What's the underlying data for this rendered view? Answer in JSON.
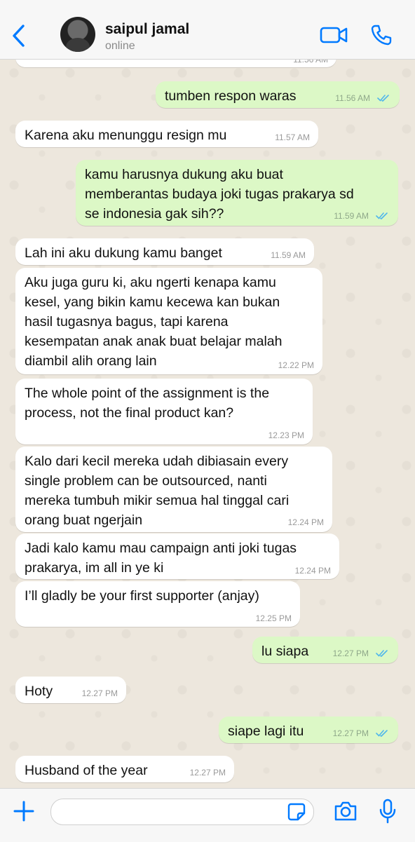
{
  "header": {
    "name": "saipul jamal",
    "status": "online"
  },
  "partial_time": "11.56 AM",
  "messages": [
    {
      "dir": "out",
      "text": "tumben respon waras",
      "time": "11.56 AM",
      "ticks": true
    },
    {
      "dir": "in",
      "text": "Karena aku menunggu resign mu",
      "time": "11.57 AM"
    },
    {
      "dir": "out",
      "text": "kamu harusnya dukung aku buat\nmemberantas budaya joki tugas prakarya sd\nse indonesia gak sih??",
      "time": "11.59 AM",
      "ticks": true
    },
    {
      "dir": "in",
      "text": "Lah ini aku dukung kamu banget",
      "time": "11.59 AM"
    },
    {
      "dir": "in",
      "text": "Aku juga guru ki, aku ngerti kenapa kamu\nkesel, yang bikin kamu kecewa kan bukan\nhasil tugasnya bagus, tapi karena\nkesempatan anak anak buat belajar malah\ndiambil alih orang lain",
      "time": "12.22 PM"
    },
    {
      "dir": "in",
      "text": "The whole point of the assignment is the\nprocess, not the final product kan?",
      "time": "12.23 PM"
    },
    {
      "dir": "in",
      "text": "Kalo dari kecil mereka udah dibiasain every\nsingle problem can be outsourced, nanti\nmereka tumbuh mikir semua hal tinggal cari\norang buat ngerjain",
      "time": "12.24 PM"
    },
    {
      "dir": "in",
      "text": "Jadi kalo kamu mau campaign anti joki tugas\nprakarya, im all in ye ki",
      "time": "12.24 PM"
    },
    {
      "dir": "in",
      "text": "I’ll gladly be your first supporter (anjay)",
      "time": "12.25 PM"
    },
    {
      "dir": "out",
      "text": "lu siapa",
      "time": "12.27 PM",
      "ticks": true
    },
    {
      "dir": "in",
      "text": "Hoty",
      "time": "12.27 PM"
    },
    {
      "dir": "out",
      "text": "siape lagi itu",
      "time": "12.27 PM",
      "ticks": true
    },
    {
      "dir": "in",
      "text": "Husband of the year",
      "time": "12.27 PM"
    }
  ],
  "input": {
    "placeholder": ""
  },
  "colors": {
    "accent": "#007aff",
    "outgoing": "#dcf8c6",
    "incoming": "#ffffff",
    "read_ticks": "#4fb6ec"
  }
}
